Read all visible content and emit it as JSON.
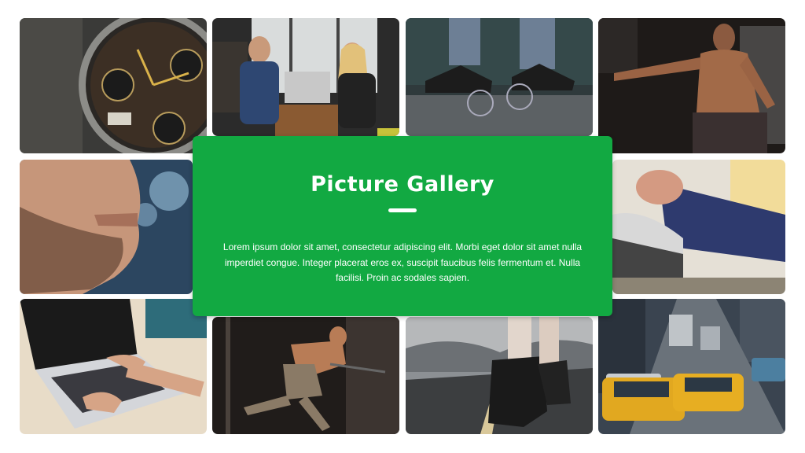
{
  "gallery": {
    "title": "Picture Gallery",
    "description": "Lorem ipsum dolor sit amet, consectetur adipiscing elit. Morbi eget dolor sit amet nulla imperdiet congue. Integer placerat eros ex, suscipit faucibus felis fermentum et. Nulla facilisi. Proin ac sodales sapien.",
    "accent_color": "#12a942"
  },
  "photos": [
    {
      "subject": "wristwatch"
    },
    {
      "subject": "business-meeting"
    },
    {
      "subject": "sneakers-and-glasses"
    },
    {
      "subject": "fitness-man"
    },
    {
      "subject": "man-face"
    },
    {
      "subject": "tying-shoelace"
    },
    {
      "subject": "laptop-typing"
    },
    {
      "subject": "gym-workout"
    },
    {
      "subject": "running-road"
    },
    {
      "subject": "city-taxis"
    }
  ]
}
